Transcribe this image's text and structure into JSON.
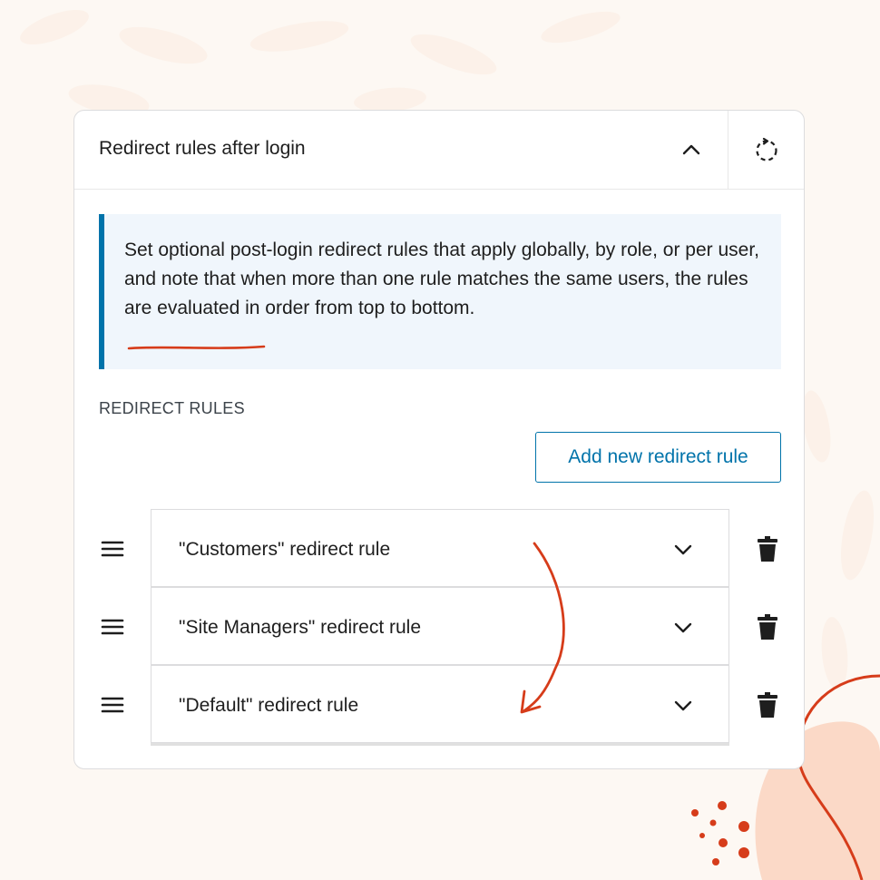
{
  "panel": {
    "title": "Redirect rules after login",
    "collapse_icon": "chevron-up-icon",
    "reset_icon": "reset-dashed-icon"
  },
  "notice": {
    "text_before": "Set optional post-login redirect rules that apply globally, by role, or per user, and note that when more than one rule matches the same users, the rules are evaluated in order from ",
    "highlight": "top to bottom",
    "text_after": ".",
    "accent_color": "#0073aa",
    "underline_color": "#d63c1a"
  },
  "rules_section": {
    "label": "REDIRECT RULES",
    "add_button_label": "Add new redirect rule",
    "rules": [
      {
        "label": "\"Customers\" redirect rule"
      },
      {
        "label": "\"Site Managers\" redirect rule"
      },
      {
        "label": "\"Default\" redirect rule"
      }
    ]
  },
  "colors": {
    "background": "#fdf8f3",
    "accent": "#0073aa",
    "annotation": "#d63c1a"
  }
}
